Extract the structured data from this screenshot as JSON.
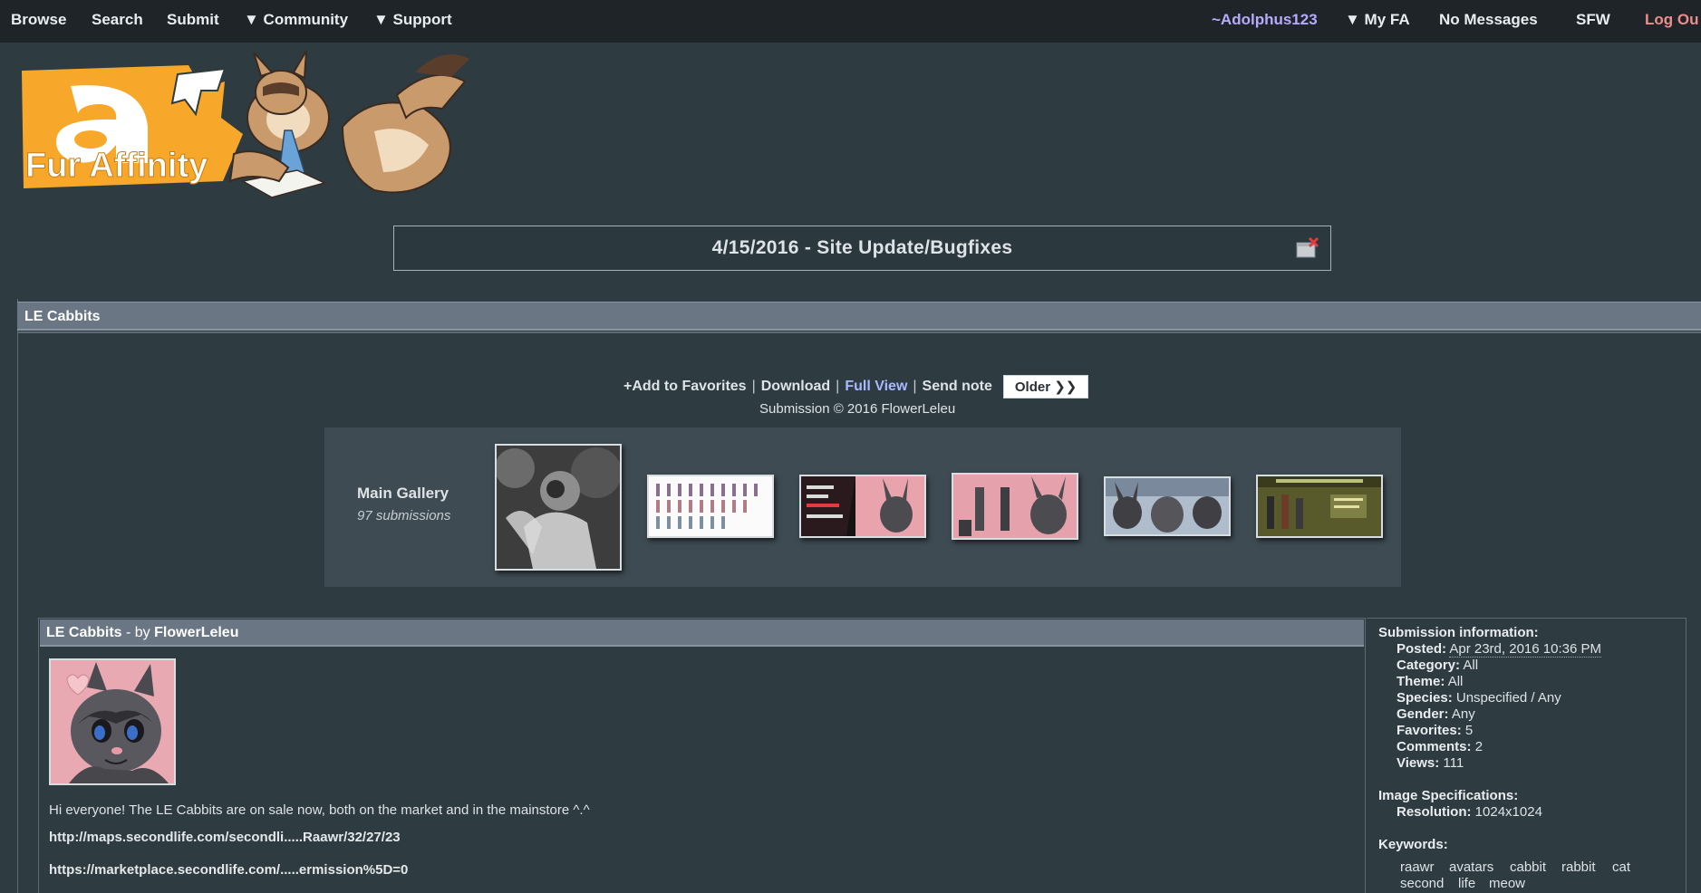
{
  "nav": {
    "browse": "Browse",
    "search": "Search",
    "submit": "Submit",
    "community": "▼ Community",
    "support": "▼ Support",
    "user": "~Adolphus123",
    "myfa": "▼ My FA",
    "messages": "No Messages",
    "sfw": "SFW",
    "logout": "Log Ou"
  },
  "logo": {
    "text": "Fur Affinity"
  },
  "notice": {
    "title": "4/15/2016 - Site Update/Bugfixes"
  },
  "section": {
    "title": "LE Cabbits"
  },
  "actions": {
    "favorite": "+Add to Favorites",
    "download": "Download",
    "fullview": "Full View",
    "note": "Send note",
    "sep": "|",
    "older": "Older ❯❯"
  },
  "copyright": "Submission © 2016 FlowerLeleu",
  "gallery": {
    "title": "Main Gallery",
    "count": "97 submissions"
  },
  "submission": {
    "title": "LE Cabbits",
    "by": " - by ",
    "author": "FlowerLeleu",
    "description": "Hi everyone! The LE Cabbits are on sale now, both on the market and in the mainstore ^.^",
    "link1": "http://maps.secondlife.com/secondli.....Raawr/32/27/23",
    "link2": "https://marketplace.secondlife.com/.....ermission%5D=0"
  },
  "info": {
    "heading": "Submission information:",
    "posted_label": "Posted:",
    "posted": "Apr 23rd, 2016 10:36 PM",
    "category_label": "Category:",
    "category": "All",
    "theme_label": "Theme:",
    "theme": "All",
    "species_label": "Species:",
    "species": "Unspecified / Any",
    "gender_label": "Gender:",
    "gender": "Any",
    "favorites_label": "Favorites:",
    "favorites": "5",
    "comments_label": "Comments:",
    "comments": "2",
    "views_label": "Views:",
    "views": "111",
    "spec_heading": "Image Specifications:",
    "resolution_label": "Resolution:",
    "resolution": "1024x1024",
    "keywords_heading": "Keywords:",
    "keywords": [
      "raawr",
      "avatars",
      "cabbit",
      "rabbit",
      "cat",
      "second",
      "life",
      "meow"
    ]
  },
  "colors": {
    "background": "#2e3b41",
    "nav": "#1e2427",
    "header_bar": "#6b7684",
    "user_link": "#b8aaff",
    "logout_link": "#f08c8c",
    "logo_orange": "#f7a82a"
  }
}
